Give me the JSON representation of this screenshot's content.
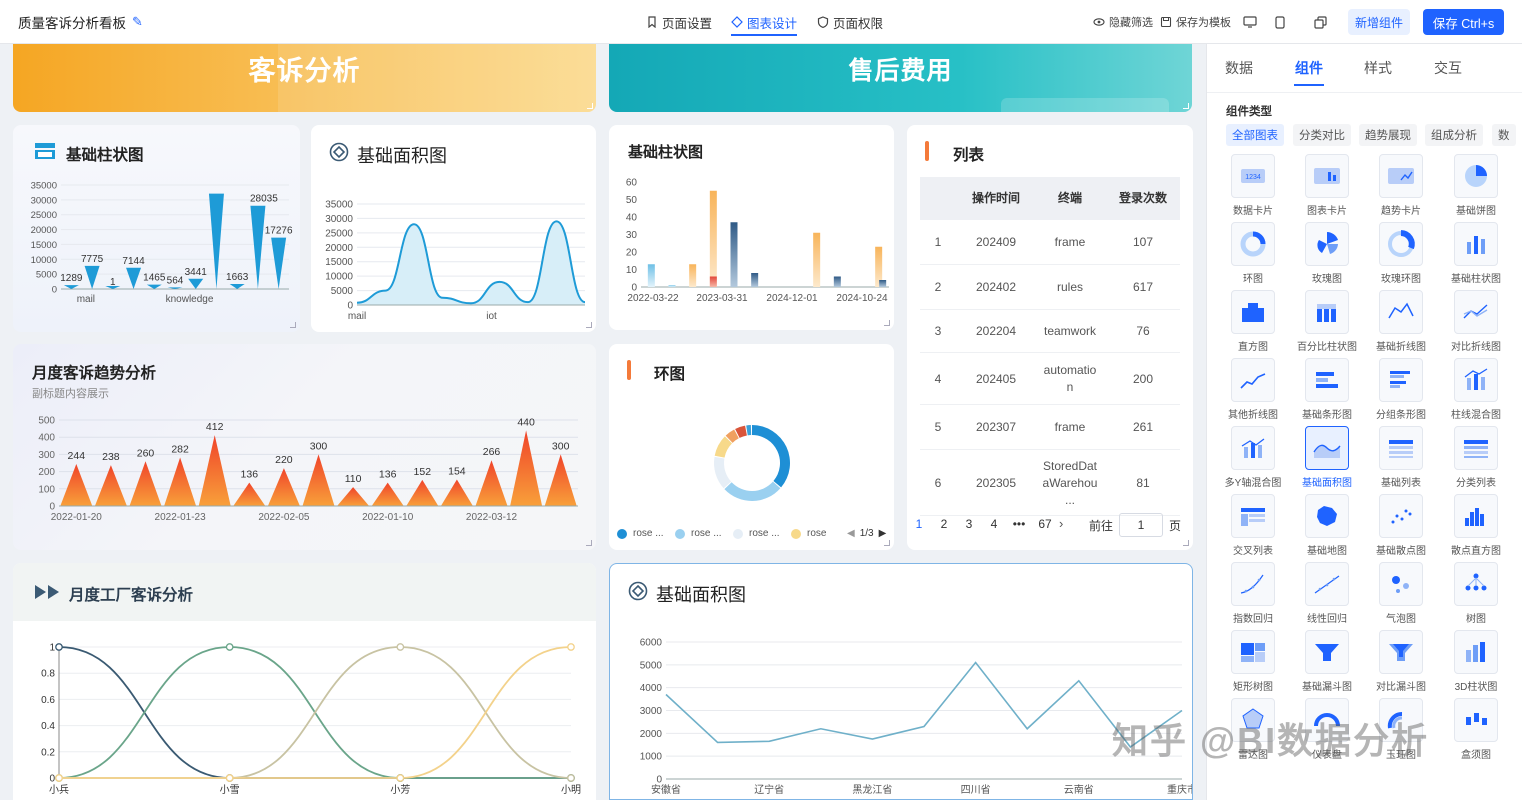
{
  "topbar": {
    "title": "质量客诉分析看板",
    "nav": [
      "页面设置",
      "图表设计",
      "页面权限"
    ],
    "actions": {
      "hide_filter": "隐藏筛选",
      "save_template": "保存为模板",
      "add_component": "新增组件",
      "save": "保存 Ctrl+s"
    }
  },
  "banners": {
    "left": "客诉分析",
    "right": "售后费用"
  },
  "cards": {
    "bar1": {
      "title": "基础柱状图"
    },
    "area1": {
      "title": "基础面积图"
    },
    "bar2": {
      "title": "基础柱状图"
    },
    "list": {
      "title": "列表"
    },
    "trend": {
      "title": "月度客诉趋势分析",
      "subtitle": "副标题内容展示"
    },
    "ring": {
      "title": "环图"
    },
    "factory": {
      "title": "月度工厂客诉分析"
    },
    "area2": {
      "title": "基础面积图"
    }
  },
  "table": {
    "headers": [
      "操作时间",
      "终端",
      "登录次数"
    ],
    "rows": [
      {
        "idx": "1",
        "time": "202409",
        "terminal": "frame",
        "count": "107"
      },
      {
        "idx": "2",
        "time": "202402",
        "terminal": "rules",
        "count": "617"
      },
      {
        "idx": "3",
        "time": "202204",
        "terminal": "teamwork",
        "count": "76"
      },
      {
        "idx": "4",
        "time": "202405",
        "terminal": "automatio n",
        "count": "200"
      },
      {
        "idx": "5",
        "time": "202307",
        "terminal": "frame",
        "count": "261"
      },
      {
        "idx": "6",
        "time": "202305",
        "terminal": "StoredDat aWarehou ...",
        "count": "81"
      }
    ],
    "pagination": {
      "pages": [
        "1",
        "2",
        "3",
        "4",
        "•••",
        "67"
      ],
      "next": "›",
      "goto_label": "前往",
      "goto_value": "1",
      "page_unit": "页"
    }
  },
  "ring_legend": {
    "items": [
      "rose ...",
      "rose ...",
      "rose ...",
      "rose"
    ],
    "page": "1/3"
  },
  "right_panel": {
    "tabs": [
      "数据",
      "组件",
      "样式",
      "交互"
    ],
    "type_label": "组件类型",
    "chips": [
      "全部图表",
      "分类对比",
      "趋势展现",
      "组成分析",
      "数"
    ],
    "components": [
      "数据卡片",
      "图表卡片",
      "趋势卡片",
      "基础饼图",
      "环图",
      "玫瑰图",
      "玫瑰环图",
      "基础柱状图",
      "直方图",
      "百分比柱状图",
      "基础折线图",
      "对比折线图",
      "其他折线图",
      "基础条形图",
      "分组条形图",
      "柱线混合图",
      "多Y轴混合图",
      "基础面积图",
      "基础列表",
      "分类列表",
      "交叉列表",
      "基础地图",
      "基础散点图",
      "散点直方图",
      "指数回归",
      "线性回归",
      "气泡图",
      "树图",
      "矩形树图",
      "基础漏斗图",
      "对比漏斗图",
      "3D柱状图",
      "雷达图",
      "仪表盘",
      "玉珏图",
      "盒须图"
    ],
    "selected": "基础面积图"
  },
  "watermark": "知乎 @BI数据分析",
  "colors": {
    "primary": "#1f63ff",
    "orange": "#f5a623",
    "teal": "#1bb3b8",
    "blue": "#1e9bd7",
    "trend_red": "#f0442a"
  },
  "chart_data": [
    {
      "id": "bar1",
      "type": "bar",
      "title": "基础柱状图",
      "ylim": [
        0,
        35000
      ],
      "yticks": [
        "0",
        "5000",
        "10000",
        "15000",
        "20000",
        "25000",
        "30000",
        "35000"
      ],
      "x_labels": [
        "mail",
        "knowledge"
      ],
      "values": [
        1289,
        7775,
        1,
        7144,
        1465,
        564,
        3441,
        32110,
        1663,
        28035,
        17276
      ],
      "labels": [
        "1289",
        "7775",
        "1",
        "7144",
        "1465",
        "564",
        "3441",
        "",
        "1663",
        "28035",
        "17276"
      ]
    },
    {
      "id": "area1",
      "type": "area",
      "title": "基础面积图",
      "ylim": [
        0,
        35000
      ],
      "yticks": [
        "0",
        "5000",
        "10000",
        "15000",
        "20000",
        "25000",
        "30000",
        "35000"
      ],
      "x_labels": [
        "mail",
        "iot"
      ],
      "values": [
        800,
        5000,
        28000,
        2500,
        600,
        8000,
        1000,
        29000,
        1000
      ]
    },
    {
      "id": "bar2",
      "type": "bar",
      "title": "基础柱状图",
      "ylim": [
        0,
        60
      ],
      "yticks": [
        "0",
        "10",
        "20",
        "30",
        "40",
        "50",
        "60"
      ],
      "x_labels": [
        "2022-03-22",
        "2023-03-31",
        "2024-12-01",
        "2024-10-24"
      ],
      "series": [
        {
          "values": [
            13,
            1,
            0,
            0,
            0,
            0,
            0,
            0,
            0,
            0,
            0,
            0
          ]
        },
        {
          "values": [
            0,
            0,
            13,
            55,
            0,
            0,
            0,
            0,
            31,
            0,
            0,
            23
          ]
        },
        {
          "values": [
            0,
            0,
            0,
            6,
            0,
            0,
            0,
            0,
            0,
            0,
            0,
            0
          ]
        },
        {
          "values": [
            0,
            0,
            0,
            0,
            37,
            8,
            0,
            0,
            0,
            6,
            0,
            4
          ]
        }
      ]
    },
    {
      "id": "trend",
      "type": "bar",
      "title": "月度客诉趋势分析",
      "ylim": [
        0,
        500
      ],
      "yticks": [
        "0",
        "100",
        "200",
        "300",
        "400",
        "500"
      ],
      "x_labels": [
        "2022-01-20",
        "2022-01-23",
        "2022-02-05",
        "2022-01-10",
        "2022-03-12"
      ],
      "values": [
        244,
        238,
        260,
        282,
        412,
        136,
        220,
        300,
        110,
        136,
        152,
        154,
        266,
        440,
        300
      ]
    },
    {
      "id": "ring",
      "type": "pie",
      "title": "环图",
      "values": [
        30,
        22,
        12,
        8,
        4,
        4,
        2
      ],
      "colors": [
        "#1e8fd5",
        "#9ad0f0",
        "#e6eef6",
        "#f7d98a",
        "#f0a060",
        "#d9553a",
        "#3ba0d8"
      ]
    },
    {
      "id": "factory",
      "type": "line",
      "title": "月度工厂客诉分析",
      "ylim": [
        0,
        1
      ],
      "yticks": [
        "0",
        "0.2",
        "0.4",
        "0.6",
        "0.8",
        "1"
      ],
      "categories": [
        "小兵",
        "小雪",
        "小芳",
        "小明"
      ],
      "series": [
        {
          "values": [
            1,
            0,
            0,
            0
          ],
          "color": "#3a5a72"
        },
        {
          "values": [
            0,
            1,
            0,
            0
          ],
          "color": "#6aa58a"
        },
        {
          "values": [
            0,
            0,
            1,
            0
          ],
          "color": "#c8c3a3"
        },
        {
          "values": [
            0,
            0,
            0,
            1
          ],
          "color": "#f3d28b"
        }
      ]
    },
    {
      "id": "area2",
      "type": "line",
      "title": "基础面积图",
      "ylim": [
        0,
        6000
      ],
      "yticks": [
        "0",
        "1000",
        "2000",
        "3000",
        "4000",
        "5000",
        "6000"
      ],
      "x_labels": [
        "安徽省",
        "辽宁省",
        "黑龙江省",
        "四川省",
        "云南省",
        "重庆市"
      ],
      "values": [
        3700,
        1600,
        1650,
        2200,
        1750,
        2300,
        5100,
        2200,
        4300,
        1400,
        3000
      ]
    }
  ]
}
